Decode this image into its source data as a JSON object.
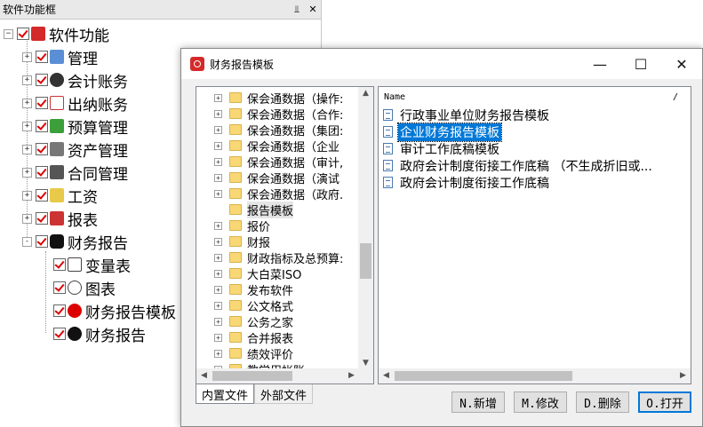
{
  "left_panel": {
    "title": "软件功能框",
    "pin_icon": "pin-icon",
    "close_icon": "close-icon",
    "root": "软件功能",
    "items": [
      {
        "label": "管理",
        "icon": "management-icon",
        "expander": "+"
      },
      {
        "label": "会计账务",
        "icon": "accounting-icon",
        "expander": "+"
      },
      {
        "label": "出纳账务",
        "icon": "cashier-icon",
        "expander": "+"
      },
      {
        "label": "预算管理",
        "icon": "budget-icon",
        "expander": "+"
      },
      {
        "label": "资产管理",
        "icon": "asset-icon",
        "expander": "+"
      },
      {
        "label": "合同管理",
        "icon": "contract-icon",
        "expander": "+"
      },
      {
        "label": "工资",
        "icon": "salary-icon",
        "expander": "+"
      },
      {
        "label": "报表",
        "icon": "report-icon",
        "expander": "+"
      },
      {
        "label": "财务报告",
        "icon": "finance-report-icon",
        "expander": "-"
      }
    ],
    "sub_items": [
      {
        "label": "变量表",
        "icon": "variable-table-icon"
      },
      {
        "label": "图表",
        "icon": "chart-icon"
      },
      {
        "label": "财务报告模板",
        "icon": "report-template-icon"
      },
      {
        "label": "财务报告",
        "icon": "finance-report-sub-icon"
      }
    ]
  },
  "dialog": {
    "title": "财务报告模板",
    "minimize": "—",
    "maximize": "☐",
    "close": "✕",
    "folders": [
      {
        "label": "保会通数据（操作:",
        "expander": "+"
      },
      {
        "label": "保会通数据（合作:",
        "expander": "+"
      },
      {
        "label": "保会通数据（集团:",
        "expander": "+"
      },
      {
        "label": "保会通数据（企业",
        "expander": "+"
      },
      {
        "label": "保会通数据（审计,",
        "expander": "+"
      },
      {
        "label": "保会通数据（演试",
        "expander": "+"
      },
      {
        "label": "保会通数据（政府.",
        "expander": "+"
      },
      {
        "label": "报告模板",
        "expander": ""
      },
      {
        "label": "报价",
        "expander": "+"
      },
      {
        "label": "财报",
        "expander": "+"
      },
      {
        "label": "财政指标及总预算:",
        "expander": "+"
      },
      {
        "label": "大白菜ISO",
        "expander": "+"
      },
      {
        "label": "发布软件",
        "expander": "+"
      },
      {
        "label": "公文格式",
        "expander": "+"
      },
      {
        "label": "公务之家",
        "expander": "+"
      },
      {
        "label": "合并报表",
        "expander": "+"
      },
      {
        "label": "绩效评价",
        "expander": "+"
      },
      {
        "label": "教学用帐账",
        "expander": "+"
      }
    ],
    "list_header": {
      "name": "Name",
      "sort": "/"
    },
    "files": [
      {
        "label": "行政事业单位财务报告模板"
      },
      {
        "label": "企业财务报告模板"
      },
      {
        "label": "审计工作底稿模板"
      },
      {
        "label": "政府会计制度衔接工作底稿 （不生成折旧或..."
      },
      {
        "label": "政府会计制度衔接工作底稿"
      }
    ],
    "tabs": [
      "内置文件",
      "外部文件"
    ],
    "buttons": {
      "new": "N.新增",
      "modify": "M.修改",
      "delete": "D.删除",
      "open": "O.打开"
    }
  }
}
